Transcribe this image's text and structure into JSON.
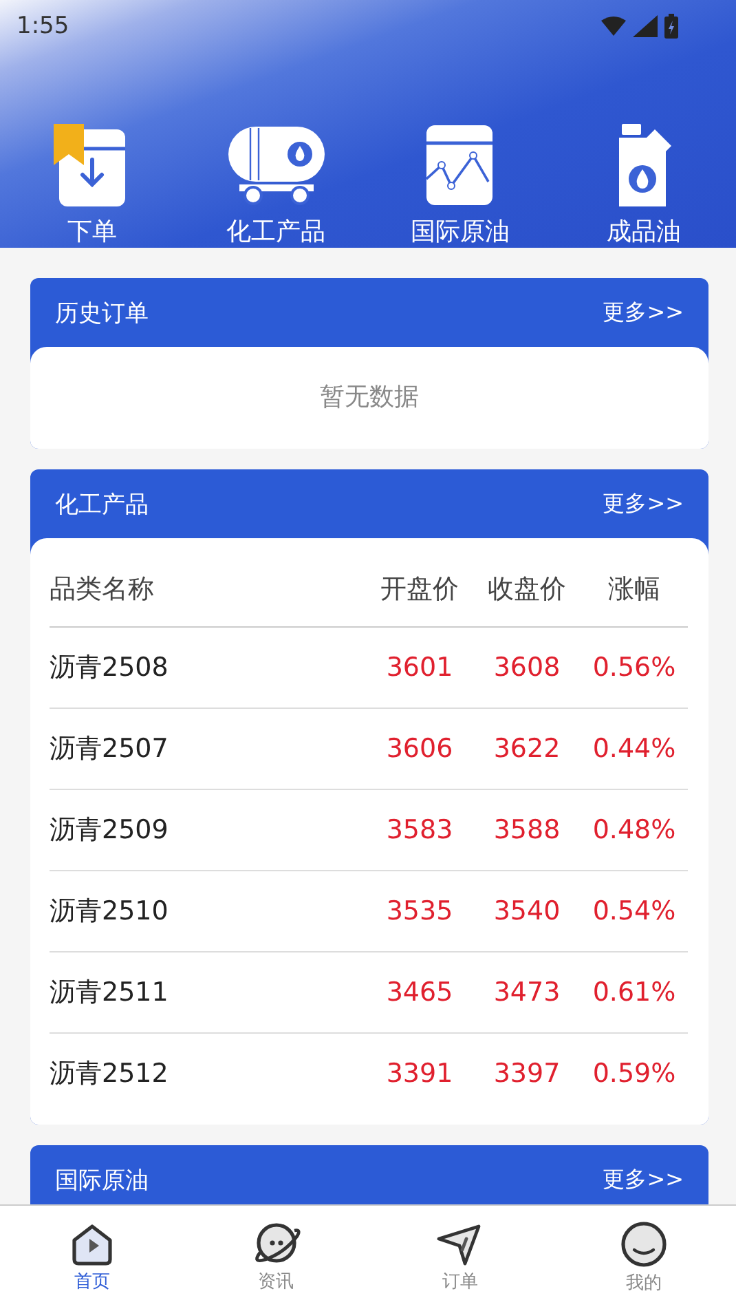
{
  "status_bar": {
    "time": "1:55"
  },
  "shortcuts": [
    {
      "label": "下单"
    },
    {
      "label": "化工产品"
    },
    {
      "label": "国际原油"
    },
    {
      "label": "成品油"
    }
  ],
  "sections": [
    {
      "title": "历史订单",
      "more": "更多>>",
      "kind": "empty",
      "empty_text": "暂无数据"
    },
    {
      "title": "化工产品",
      "more": "更多>>",
      "kind": "table",
      "columns": [
        "品类名称",
        "开盘价",
        "收盘价",
        "涨幅"
      ],
      "rows": [
        [
          "沥青2508",
          "3601",
          "3608",
          "0.56%"
        ],
        [
          "沥青2507",
          "3606",
          "3622",
          "0.44%"
        ],
        [
          "沥青2509",
          "3583",
          "3588",
          "0.48%"
        ],
        [
          "沥青2510",
          "3535",
          "3540",
          "0.54%"
        ],
        [
          "沥青2511",
          "3465",
          "3473",
          "0.61%"
        ],
        [
          "沥青2512",
          "3391",
          "3397",
          "0.59%"
        ]
      ]
    },
    {
      "title": "国际原油",
      "more": "更多>>",
      "kind": "blank"
    }
  ],
  "nav": [
    {
      "label": "首页",
      "selected": true
    },
    {
      "label": "资讯",
      "selected": false
    },
    {
      "label": "订单",
      "selected": false
    },
    {
      "label": "我的",
      "selected": false
    }
  ]
}
